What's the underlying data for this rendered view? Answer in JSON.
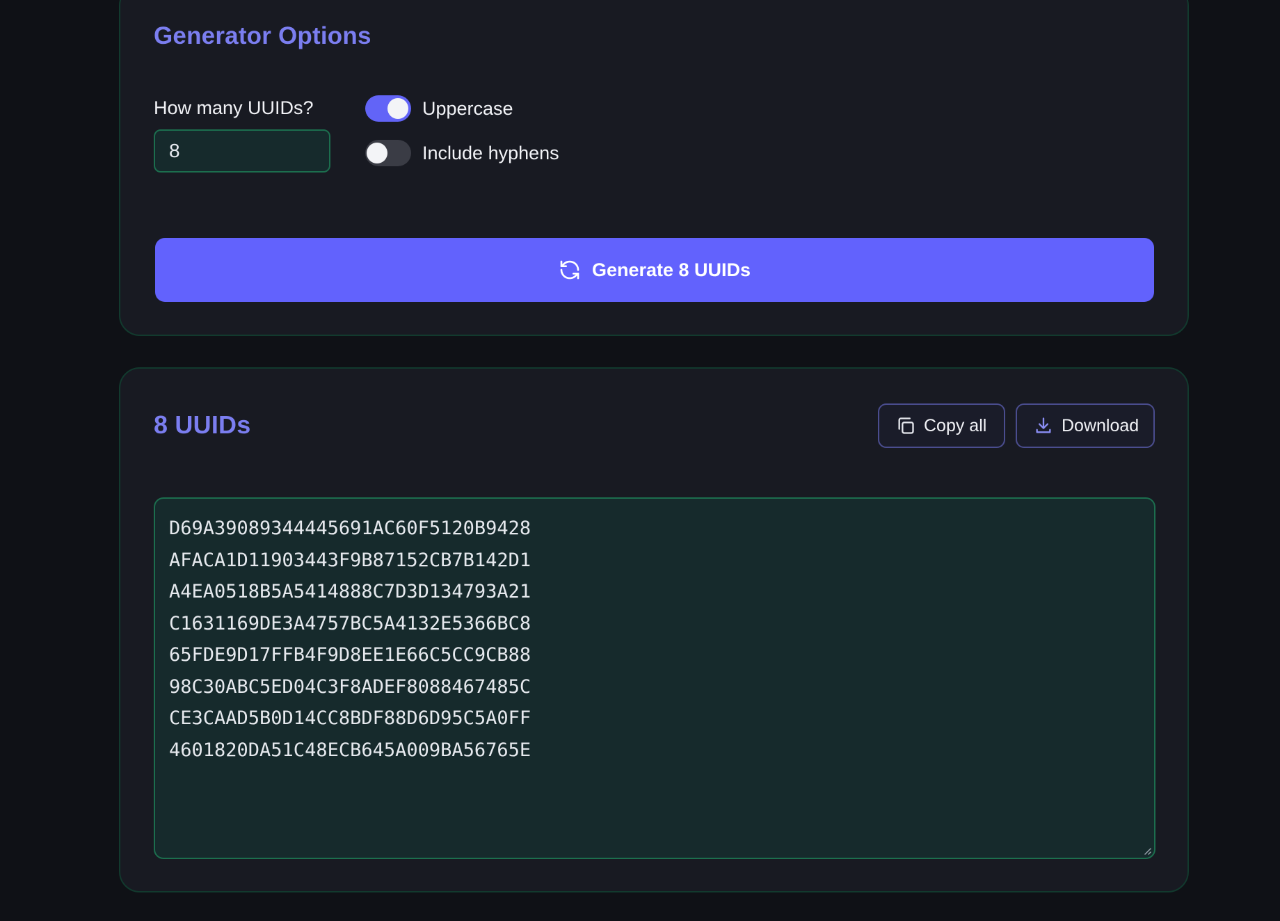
{
  "options": {
    "title": "Generator Options",
    "count_label": "How many UUIDs?",
    "count_value": "8",
    "toggles": [
      {
        "label": "Uppercase",
        "on": true
      },
      {
        "label": "Include hyphens",
        "on": false
      }
    ],
    "generate_label": "Generate 8 UUIDs",
    "generate_icon": "refresh-icon"
  },
  "results": {
    "title": "8 UUIDs",
    "copy_label": "Copy all",
    "copy_icon": "copy-icon",
    "download_label": "Download",
    "download_icon": "download-icon",
    "uuids": [
      "D69A39089344445691AC60F5120B9428",
      "AFACA1D11903443F9B87152CB7B142D1",
      "A4EA0518B5A5414888C7D3D134793A21",
      "C1631169DE3A4757BC5A4132E5366BC8",
      "65FDE9D17FFB4F9D8EE1E66C5CC9CB88",
      "98C30ABC5ED04C3F8ADEF8088467485C",
      "CE3CAAD5B0D14CC8BDF88D6D95C5A0FF",
      "4601820DA51C48ECB645A009BA56765E"
    ]
  },
  "colors": {
    "accent": "#6262fd",
    "title": "#7b7ef0",
    "field_border": "#1c6e4e",
    "background": "#0f1116",
    "card": "#181a22"
  }
}
